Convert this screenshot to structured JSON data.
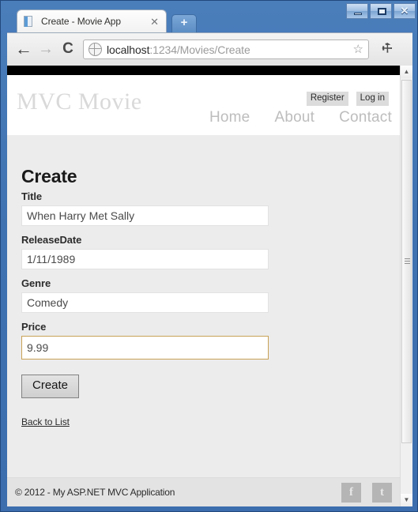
{
  "window": {
    "controls": {
      "minimize": "–",
      "maximize": "□",
      "close": "✕"
    }
  },
  "browser": {
    "tab": {
      "title": "Create - Movie App",
      "close_label": "✕",
      "favicon": "document-icon"
    },
    "new_tab_label": "+",
    "nav": {
      "back": "←",
      "forward": "→",
      "reload": "C"
    },
    "address_bar": {
      "host": "localhost",
      "path": ":1234/Movies/Create",
      "full_url": "localhost:1234/Movies/Create",
      "site_icon": "globe-icon",
      "bookmark_icon": "☆"
    },
    "menu_icon": "⚒"
  },
  "site": {
    "brand": "MVC Movie",
    "auth": [
      {
        "label": "Register"
      },
      {
        "label": "Log in"
      }
    ],
    "nav": [
      {
        "label": "Home"
      },
      {
        "label": "About"
      },
      {
        "label": "Contact"
      }
    ]
  },
  "main": {
    "heading": "Create",
    "fields": [
      {
        "label": "Title",
        "value": "When Harry Met Sally",
        "focused": false
      },
      {
        "label": "ReleaseDate",
        "value": "1/11/1989",
        "focused": false
      },
      {
        "label": "Genre",
        "value": "Comedy",
        "focused": false
      },
      {
        "label": "Price",
        "value": "9.99",
        "focused": true
      }
    ],
    "submit_label": "Create",
    "back_link": "Back to List"
  },
  "footer": {
    "copyright": "© 2012 - My ASP.NET MVC Application",
    "social": [
      {
        "name": "facebook-icon",
        "glyph": "f"
      },
      {
        "name": "twitter-icon",
        "glyph": "t"
      }
    ]
  },
  "colors": {
    "focus_border": "#c9a257",
    "body_bg": "#ececec",
    "chrome_blue": "#3c6eae"
  }
}
